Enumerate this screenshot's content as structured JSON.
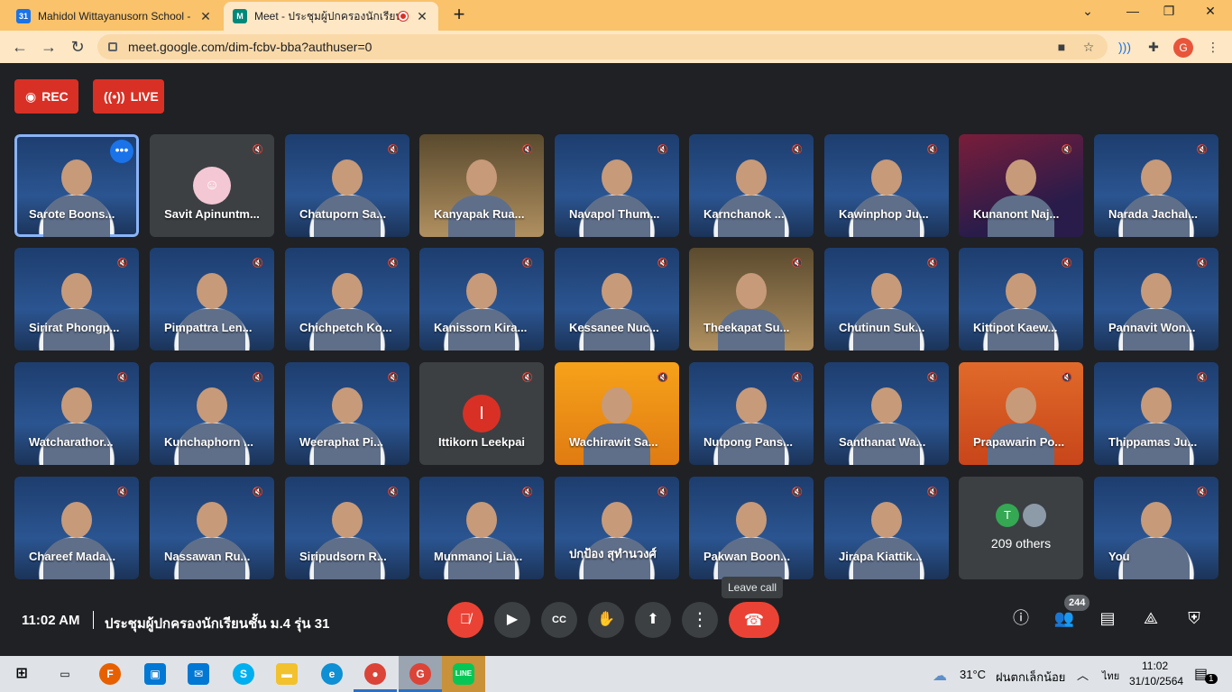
{
  "browser": {
    "tabs": [
      {
        "title": "Mahidol Wittayanusorn School -",
        "favicon_text": "31",
        "favicon_color": "#1a73e8",
        "active": false
      },
      {
        "title": "Meet - ประชุมผู้ปกครองนักเรียน",
        "favicon_text": "M",
        "favicon_color": "#00897b",
        "active": true
      }
    ],
    "url": "meet.google.com/dim-fcbv-bba?authuser=0",
    "profile_initial": "G",
    "accent_color": "#f9c26b"
  },
  "meet": {
    "rec_label": "REC",
    "live_label": "LIVE",
    "participants": [
      {
        "name": "Sarote Boons...",
        "bg": "halloween",
        "selected": true,
        "more": true
      },
      {
        "name": "Savit Apinuntm...",
        "bg": "dark",
        "avatar": "cartoon"
      },
      {
        "name": "Chatuporn Sa...",
        "bg": "halloween"
      },
      {
        "name": "Kanyapak Rua...",
        "bg": "photo"
      },
      {
        "name": "Navapol Thum...",
        "bg": "halloween"
      },
      {
        "name": "Karnchanok ...",
        "bg": "halloween"
      },
      {
        "name": "Kawinphop Ju...",
        "bg": "halloween"
      },
      {
        "name": "Kunanont Naj...",
        "bg": "space"
      },
      {
        "name": "Narada Jachal...",
        "bg": "halloween"
      },
      {
        "name": "Sirirat Phongp...",
        "bg": "halloween"
      },
      {
        "name": "Pimpattra Len...",
        "bg": "halloween"
      },
      {
        "name": "Chichpetch Ko...",
        "bg": "halloween"
      },
      {
        "name": "Kanissorn Kira...",
        "bg": "halloween"
      },
      {
        "name": "Kessanee Nuc...",
        "bg": "halloween"
      },
      {
        "name": "Theekapat Su...",
        "bg": "photo"
      },
      {
        "name": "Chutinun Suk...",
        "bg": "halloween"
      },
      {
        "name": "Kittipot Kaew...",
        "bg": "halloween"
      },
      {
        "name": "Pannavit Won...",
        "bg": "halloween"
      },
      {
        "name": "Watcharathor...",
        "bg": "halloween"
      },
      {
        "name": "Kunchaphorn ...",
        "bg": "halloween"
      },
      {
        "name": "Weeraphat Pi...",
        "bg": "halloween"
      },
      {
        "name": "Ittikorn Leekpai",
        "bg": "dark",
        "avatar": "I",
        "avatar_color": "#d93025"
      },
      {
        "name": "Wachirawit Sa...",
        "bg": "orange"
      },
      {
        "name": "Nutpong Pans...",
        "bg": "halloween"
      },
      {
        "name": "Santhanat Wa...",
        "bg": "halloween"
      },
      {
        "name": "Prapawarin Po...",
        "bg": "red"
      },
      {
        "name": "Thippamas Ju...",
        "bg": "halloween"
      },
      {
        "name": "Chareef Mada...",
        "bg": "halloween"
      },
      {
        "name": "Nassawan Ru...",
        "bg": "halloween"
      },
      {
        "name": "Siripudsorn R...",
        "bg": "halloween"
      },
      {
        "name": "Munmanoj Lia...",
        "bg": "halloween"
      },
      {
        "name": "ปกป้อง สุทำนวงศ์",
        "bg": "halloween"
      },
      {
        "name": "Pakwan Boon...",
        "bg": "halloween"
      },
      {
        "name": "Jirapa Kiattik...",
        "bg": "halloween"
      },
      {
        "others": "209 others",
        "bg": "dark",
        "mini_initial": "T",
        "mini_color": "#34a853"
      },
      {
        "name": "You",
        "bg": "halloween"
      }
    ]
  },
  "bottom": {
    "time": "11:02 AM",
    "meeting_name": "ประชุมผู้ปกครองนักเรียนชั้น ม.4 รุ่น 31",
    "tooltip": "Leave call",
    "participant_count": "244"
  },
  "taskbar": {
    "weather": "31°C",
    "weather_desc": "ฝนตกเล็กน้อย",
    "language": "ไทย",
    "clock_time": "11:02",
    "clock_date": "31/10/2564",
    "notification_count": "1"
  }
}
